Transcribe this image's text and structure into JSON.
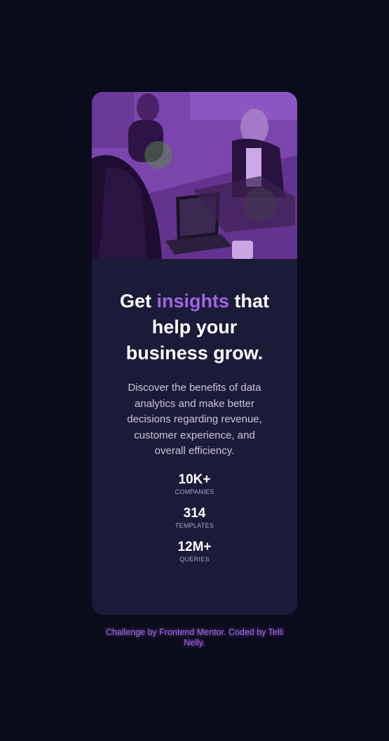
{
  "card": {
    "headline": {
      "prefix": "Get ",
      "accent": "insights",
      "suffix": " that help your business grow."
    },
    "description": "Discover the benefits of data analytics and make better decisions regarding revenue, customer experience, and overall efficiency.",
    "stats": [
      {
        "value": "10K+",
        "label": "COMPANIES"
      },
      {
        "value": "314",
        "label": "TEMPLATES"
      },
      {
        "value": "12M+",
        "label": "QUERIES"
      }
    ]
  },
  "attribution": "Challenge by Frontend Mentor. Coded by Telli Nelly.",
  "colors": {
    "page_background": "#0a0c1c",
    "card_background": "#1c1a39",
    "accent": "#a066e0",
    "image_overlay": "#6e3d9e",
    "text_primary": "#ffffff",
    "text_secondary": "#c9c6dc",
    "text_muted": "#a9a7bf"
  }
}
